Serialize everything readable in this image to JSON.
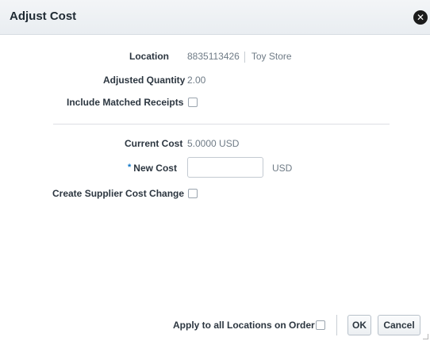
{
  "dialog": {
    "title": "Adjust Cost",
    "close_icon": "close-icon"
  },
  "form": {
    "location_label": "Location",
    "location_id": "8835113426",
    "location_name": "Toy Store",
    "adjusted_quantity_label": "Adjusted Quantity",
    "adjusted_quantity_value": "2.00",
    "include_matched_receipts_label": "Include Matched Receipts",
    "include_matched_receipts_checked": false,
    "current_cost_label": "Current Cost",
    "current_cost_value": "5.0000",
    "current_cost_currency": "USD",
    "required_marker": "*",
    "new_cost_label": "New Cost",
    "new_cost_value": "",
    "new_cost_currency": "USD",
    "create_supplier_cost_change_label": "Create Supplier Cost Change",
    "create_supplier_cost_change_checked": false
  },
  "footer": {
    "apply_all_locations_label": "Apply to all Locations on Order",
    "apply_all_locations_checked": false,
    "ok_label": "OK",
    "cancel_label": "Cancel"
  },
  "colors": {
    "header_bg": "#eef1f4",
    "required_marker": "#0d74c6",
    "label_text": "#2c3640",
    "value_text": "#6f7b86"
  }
}
